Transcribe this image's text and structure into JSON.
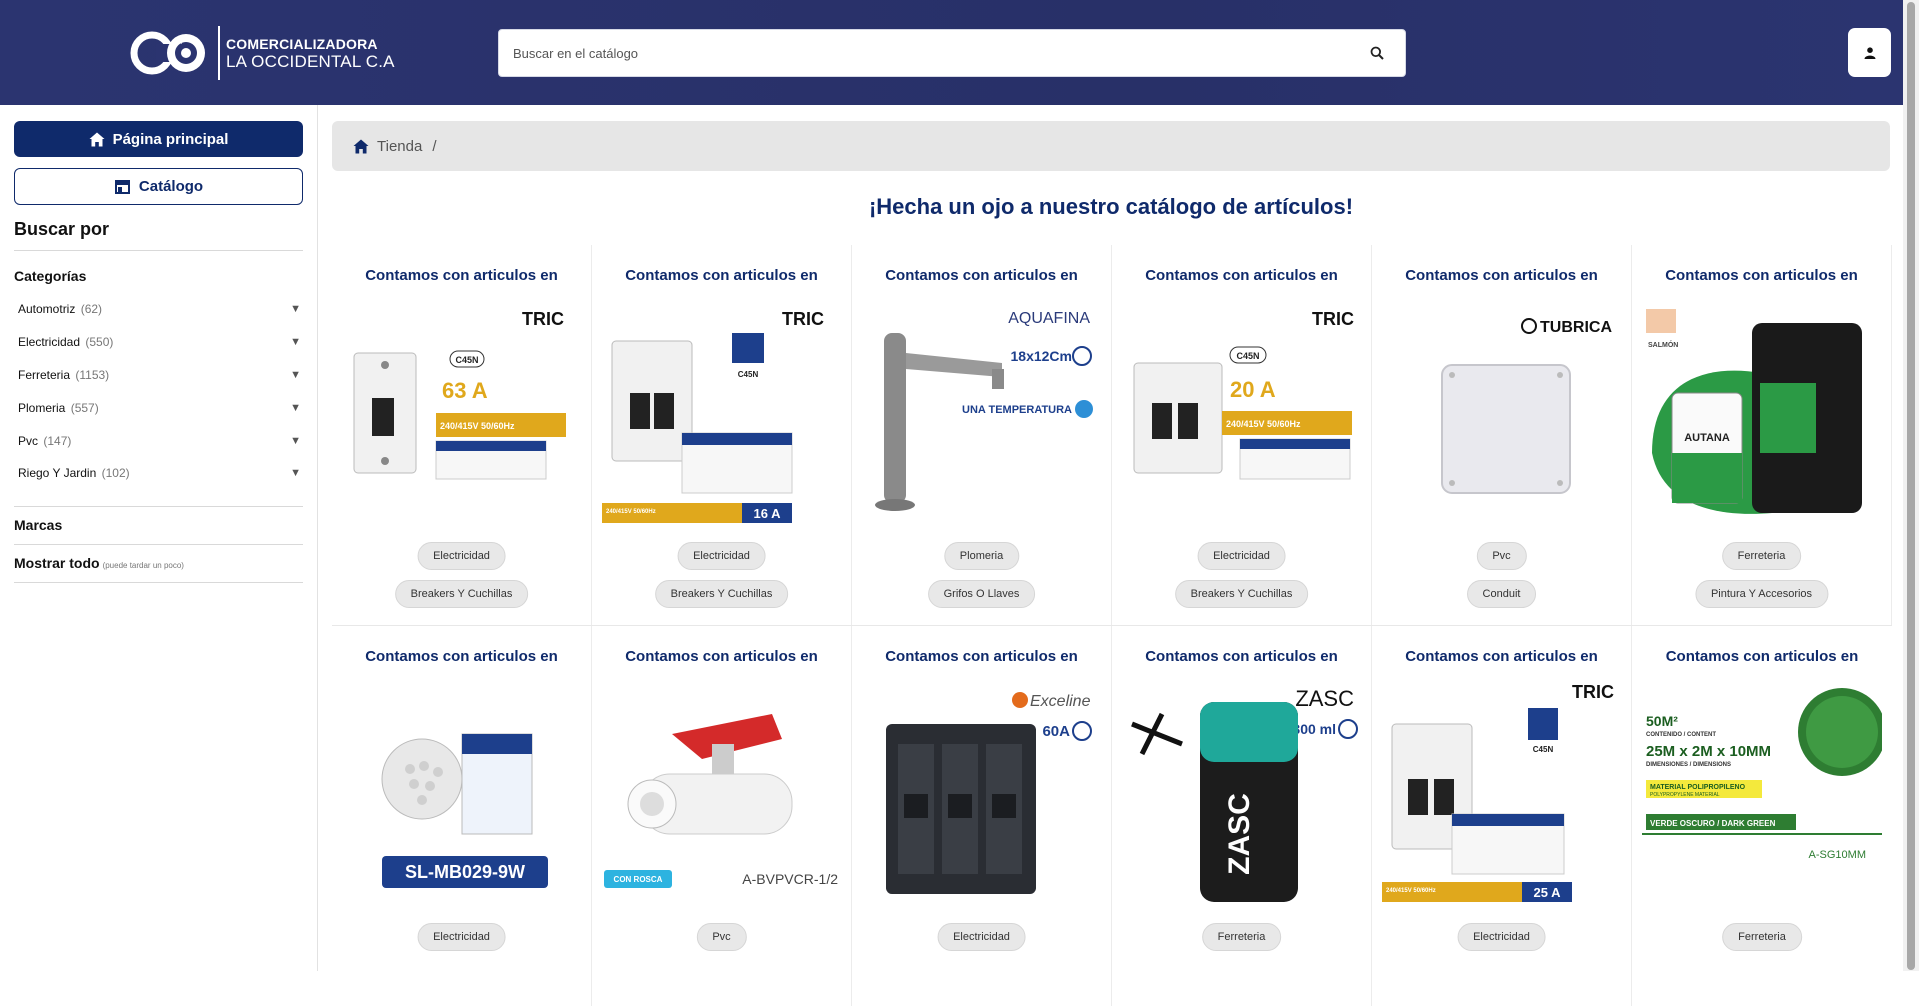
{
  "header": {
    "logo_line1": "COMERCIALIZADORA",
    "logo_line2": "LA OCCIDENTAL C.A",
    "search_placeholder": "Buscar en el catálogo"
  },
  "sidebar": {
    "home_label": "Página principal",
    "catalog_label": "Catálogo",
    "search_by": "Buscar por",
    "categories_title": "Categorías",
    "categories": [
      {
        "name": "Automotriz",
        "count": "(62)"
      },
      {
        "name": "Electricidad",
        "count": "(550)"
      },
      {
        "name": "Ferreteria",
        "count": "(1153)"
      },
      {
        "name": "Plomeria",
        "count": "(557)"
      },
      {
        "name": "Pvc",
        "count": "(147)"
      },
      {
        "name": "Riego Y Jardin",
        "count": "(102)"
      }
    ],
    "brands_title": "Marcas",
    "show_all": "Mostrar todo",
    "show_all_hint": "(puede tardar un poco)"
  },
  "breadcrumb": {
    "item": "Tienda",
    "separator": "/"
  },
  "headline": "¡Hecha un ojo a nuestro catálogo de artículos!",
  "products": [
    {
      "heading": "Contamos con articulos en",
      "category": "Electricidad",
      "subcategory": "Breakers Y Cuchillas",
      "brand": "TRIC",
      "img_text": [
        "C45N",
        "63 A",
        "240/415V 50/60Hz"
      ]
    },
    {
      "heading": "Contamos con articulos en",
      "category": "Electricidad",
      "subcategory": "Breakers Y Cuchillas",
      "brand": "TRIC",
      "img_text": [
        "C45N",
        "16 A",
        "240/415V 50/60Hz"
      ]
    },
    {
      "heading": "Contamos con articulos en",
      "category": "Plomeria",
      "subcategory": "Grifos O Llaves",
      "brand": "AQUAFINA",
      "img_text": [
        "18x12Cm",
        "UNA TEMPERATURA"
      ]
    },
    {
      "heading": "Contamos con articulos en",
      "category": "Electricidad",
      "subcategory": "Breakers Y Cuchillas",
      "brand": "TRIC",
      "img_text": [
        "C45N",
        "20 A",
        "240/415V 50/60Hz"
      ]
    },
    {
      "heading": "Contamos con articulos en",
      "category": "Pvc",
      "subcategory": "Conduit",
      "brand": "TUBRICA",
      "img_text": []
    },
    {
      "heading": "Contamos con articulos en",
      "category": "Ferreteria",
      "subcategory": "Pintura Y Accesorios",
      "brand": "",
      "img_text": [
        "SALMÓN",
        "AUTANA"
      ]
    },
    {
      "heading": "Contamos con articulos en",
      "category": "Electricidad",
      "subcategory": "",
      "brand": "",
      "img_text": [
        "SL-MB029-9W"
      ]
    },
    {
      "heading": "Contamos con articulos en",
      "category": "Pvc",
      "subcategory": "",
      "brand": "",
      "img_text": [
        "CON ROSCA",
        "A-BVPVCR-1/2"
      ]
    },
    {
      "heading": "Contamos con articulos en",
      "category": "Electricidad",
      "subcategory": "",
      "brand": "Exceline",
      "img_text": [
        "60A"
      ]
    },
    {
      "heading": "Contamos con articulos en",
      "category": "Ferreteria",
      "subcategory": "",
      "brand": "ZASC",
      "img_text": [
        "300 ml",
        "ZASC"
      ]
    },
    {
      "heading": "Contamos con articulos en",
      "category": "Electricidad",
      "subcategory": "",
      "brand": "TRIC",
      "img_text": [
        "C45N",
        "25 A",
        "240/415V 50/60Hz"
      ]
    },
    {
      "heading": "Contamos con articulos en",
      "category": "Ferreteria",
      "subcategory": "",
      "brand": "",
      "img_text": [
        "50M²",
        "CONTENIDO / CONTENT",
        "25M x 2M x 10MM",
        "DIMENSIONES / DIMENSIONS",
        "MATERIAL POLIPROPILENO",
        "POLYPROPYLENE MATERIAL",
        "VERDE OSCURO / DARK GREEN",
        "A-SG10MM"
      ]
    }
  ],
  "colors": {
    "header_bg": "#2b3470",
    "brand_primary": "#0f2a6b",
    "pill_bg": "#e8e8e8"
  }
}
